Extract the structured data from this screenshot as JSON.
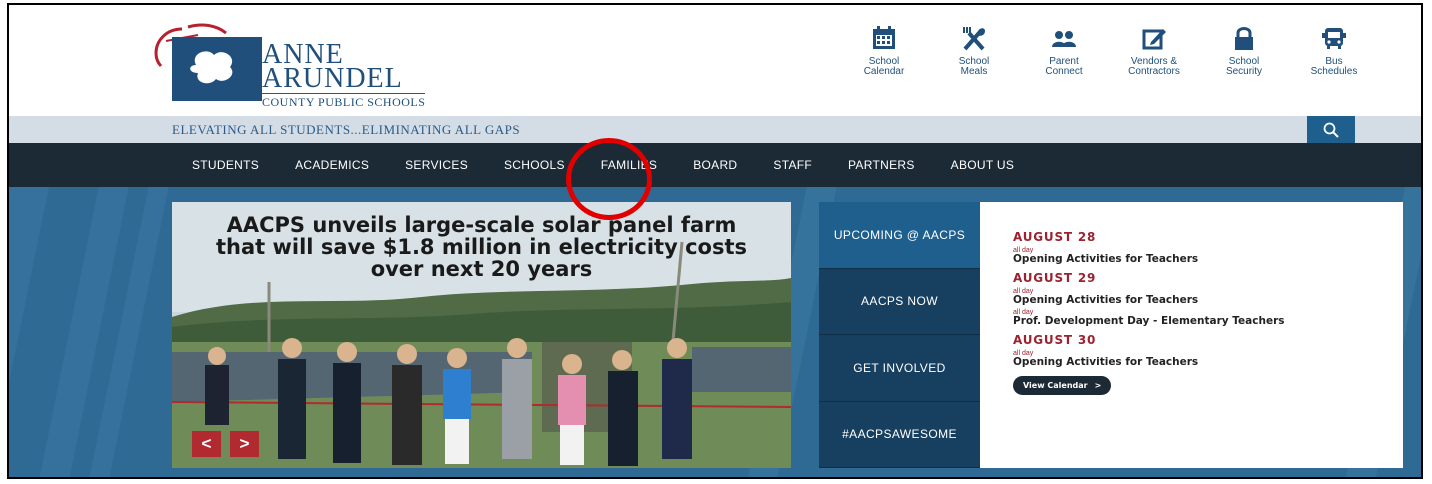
{
  "logo": {
    "line1": "ANNE",
    "line2": "ARUNDEL",
    "line3": "COUNTY PUBLIC SCHOOLS"
  },
  "quick_links": [
    {
      "label_1": "School",
      "label_2": "Calendar",
      "icon": "calendar-icon"
    },
    {
      "label_1": "School",
      "label_2": "Meals",
      "icon": "utensils-icon"
    },
    {
      "label_1": "Parent",
      "label_2": "Connect",
      "icon": "people-icon"
    },
    {
      "label_1": "Vendors &",
      "label_2": "Contractors",
      "icon": "edit-icon"
    },
    {
      "label_1": "School",
      "label_2": "Security",
      "icon": "lock-icon"
    },
    {
      "label_1": "Bus",
      "label_2": "Schedules",
      "icon": "bus-icon"
    }
  ],
  "tagline": "ELEVATING ALL STUDENTS...ELIMINATING ALL GAPS",
  "nav": [
    "STUDENTS",
    "ACADEMICS",
    "SERVICES",
    "SCHOOLS",
    "FAMILIES",
    "BOARD",
    "STAFF",
    "PARTNERS",
    "ABOUT US"
  ],
  "slide": {
    "headline_1": "AACPS unveils large-scale solar panel farm",
    "headline_2": "that will save $1.8 million in electricity costs",
    "headline_3": "over next 20 years",
    "prev": "<",
    "next": ">"
  },
  "tabs": [
    "UPCOMING @ AACPS",
    "AACPS NOW",
    "GET INVOLVED",
    "#AACPSAWESOME"
  ],
  "events": {
    "days": [
      {
        "date": "AUGUST 28",
        "items": [
          {
            "when": "all day",
            "title": "Opening Activities for Teachers"
          }
        ]
      },
      {
        "date": "AUGUST 29",
        "items": [
          {
            "when": "all day",
            "title": "Opening Activities for Teachers"
          },
          {
            "when": "all day",
            "title": "Prof. Development Day - Elementary Teachers"
          }
        ]
      },
      {
        "date": "AUGUST 30",
        "items": [
          {
            "when": "all day",
            "title": "Opening Activities for Teachers"
          }
        ]
      }
    ],
    "view_calendar": "View Calendar",
    "view_calendar_arrow": ">"
  },
  "colors": {
    "navy": "#1c2a36",
    "accent_blue": "#1e5f8e",
    "brand_red": "#9b2230",
    "annotation_red": "#e00000"
  }
}
